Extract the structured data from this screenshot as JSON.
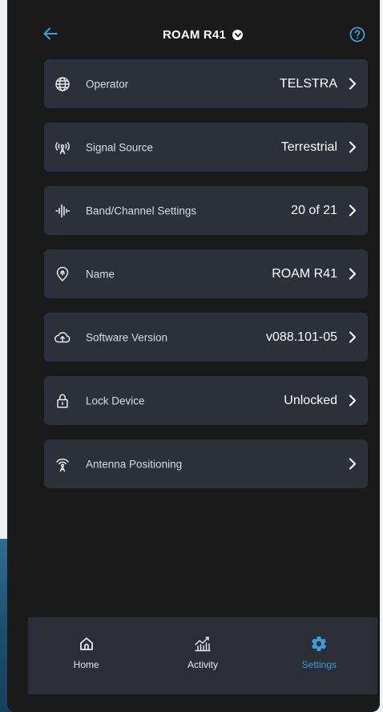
{
  "header": {
    "title": "ROAM R41",
    "back_icon": "arrow-left-icon",
    "help_icon": "help-circle-icon"
  },
  "settings": [
    {
      "key": "operator",
      "icon": "globe-icon",
      "label": "Operator",
      "value": "TELSTRA"
    },
    {
      "key": "signal-source",
      "icon": "signal-source-icon",
      "label": "Signal Source",
      "value": "Terrestrial"
    },
    {
      "key": "band-channel",
      "icon": "waveform-icon",
      "label": "Band/Channel Settings",
      "value": "20 of 21"
    },
    {
      "key": "name",
      "icon": "location-pin-icon",
      "label": "Name",
      "value": "ROAM R41"
    },
    {
      "key": "software-version",
      "icon": "cloud-upload-icon",
      "label": "Software Version",
      "value": "v088.101-05"
    },
    {
      "key": "lock-device",
      "icon": "lock-icon",
      "label": "Lock Device",
      "value": "Unlocked"
    },
    {
      "key": "antenna-positioning",
      "icon": "antenna-icon",
      "label": "Antenna Positioning",
      "value": ""
    }
  ],
  "nav": {
    "items": [
      {
        "key": "home",
        "label": "Home",
        "icon": "home-icon",
        "active": false
      },
      {
        "key": "activity",
        "label": "Activity",
        "icon": "activity-chart-icon",
        "active": false
      },
      {
        "key": "settings",
        "label": "Settings",
        "icon": "gear-icon",
        "active": true
      }
    ]
  },
  "colors": {
    "accent": "#3a9fd8",
    "row_bg": "#2c303a",
    "screen_bg": "#1a1a1b",
    "nav_bg": "#2b2e38"
  }
}
